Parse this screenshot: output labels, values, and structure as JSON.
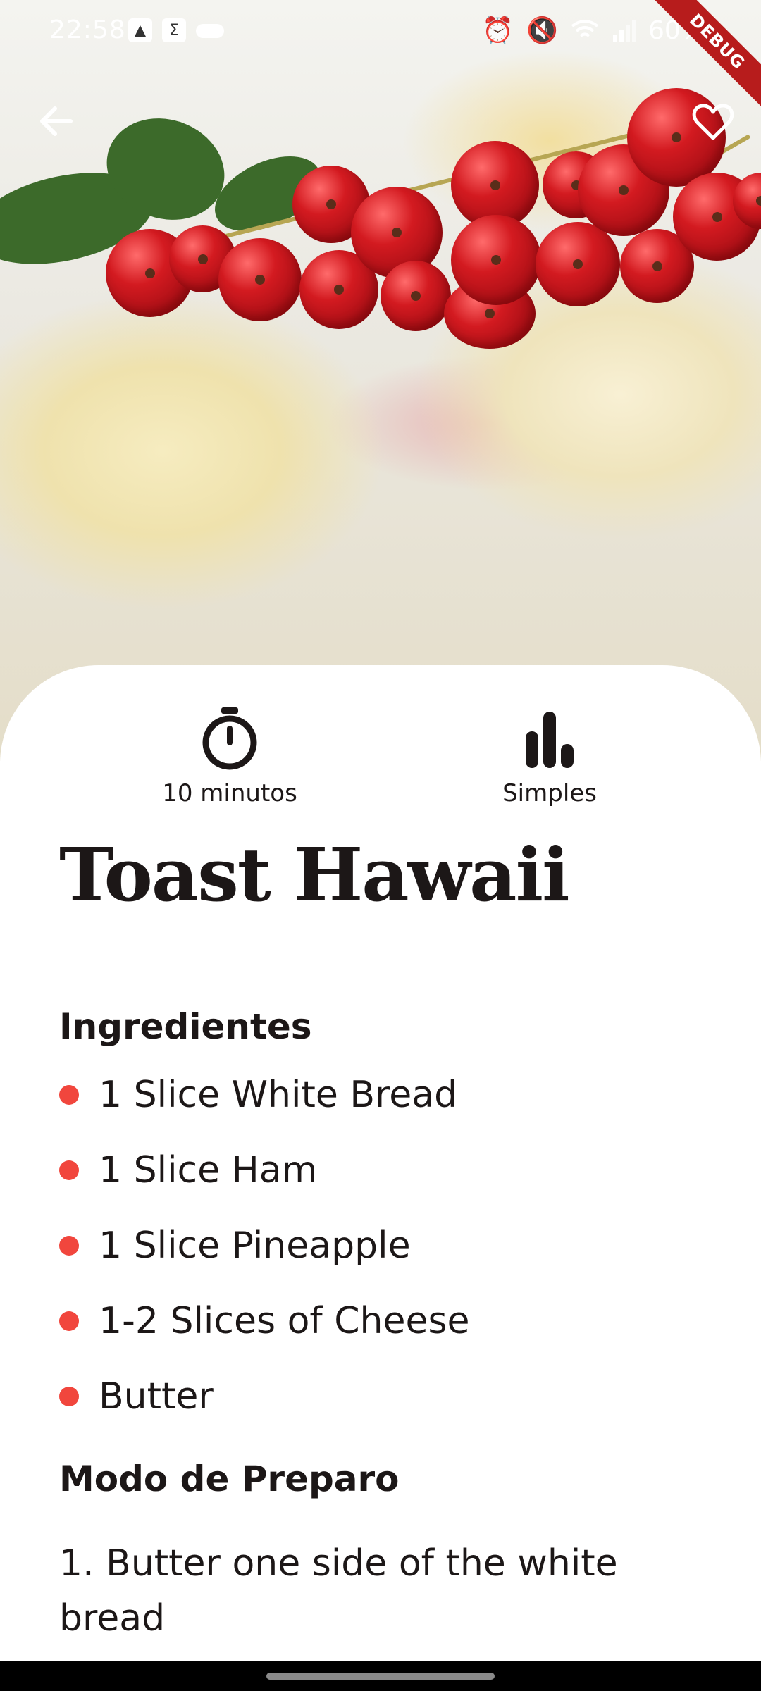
{
  "status_bar": {
    "time": "22:58",
    "battery": "60%",
    "debug_label": "DEBUG"
  },
  "recipe": {
    "time": "10 minutos",
    "difficulty": "Simples",
    "title": "Toast Hawaii",
    "ingredients_title": "Ingredientes",
    "ingredients": [
      "1 Slice White Bread",
      "1 Slice Ham",
      "1 Slice Pineapple",
      "1-2 Slices of Cheese",
      "Butter"
    ],
    "prep_title": "Modo de Preparo",
    "steps": [
      "1. Butter one side of the white bread"
    ]
  },
  "colors": {
    "bullet": "#f1463d",
    "text": "#1c1717",
    "debug_ribbon": "#b71c1c"
  },
  "icons": {
    "back": "arrow-left-icon",
    "favorite": "heart-outline-icon",
    "time": "stopwatch-icon",
    "difficulty": "bar-chart-icon"
  }
}
